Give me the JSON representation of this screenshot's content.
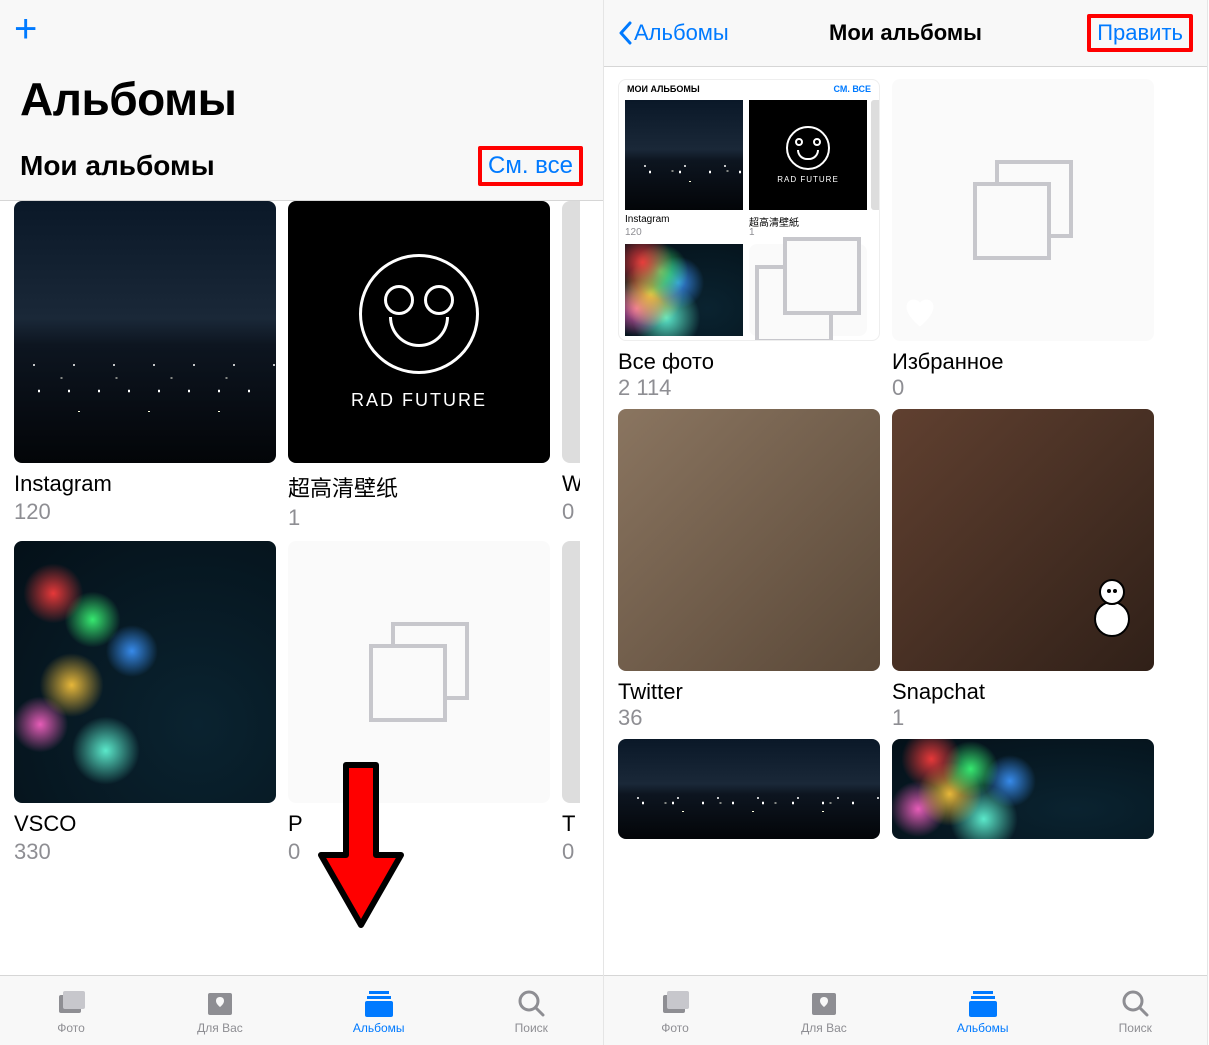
{
  "colors": {
    "accent": "#007aff",
    "highlight": "#ff0000",
    "gray": "#8e8e93"
  },
  "left": {
    "large_title": "Альбомы",
    "section_title": "Мои альбомы",
    "see_all_label": "См. все",
    "albums": [
      {
        "name": "Instagram",
        "count": "120"
      },
      {
        "name": "超高清壁纸",
        "count": "1"
      },
      {
        "name": "W",
        "count": "0"
      },
      {
        "name": "VSCO",
        "count": "330"
      },
      {
        "name": "P",
        "count": "0"
      },
      {
        "name": "T",
        "count": "0"
      }
    ]
  },
  "right": {
    "back_label": "Альбомы",
    "title": "Мои альбомы",
    "edit_label": "Править",
    "albums": [
      {
        "name": "Все фото",
        "count": "2 114"
      },
      {
        "name": "Избранное",
        "count": "0"
      },
      {
        "name": "Twitter",
        "count": "36"
      },
      {
        "name": "Snapchat",
        "count": "1"
      }
    ],
    "mini_collage": {
      "header_left": "МОИ АЛЬБОМЫ",
      "header_right": "СМ. ВСЕ",
      "item1_label": "Instagram",
      "item1_count": "120",
      "item2_label": "超高清壁紙",
      "item2_count": "1",
      "rad_text": "RAD FUTURE"
    }
  },
  "rad_future_text": "RAD FUTURE",
  "tabs": {
    "photos": "Фото",
    "for_you": "Для Вас",
    "albums": "Альбомы",
    "search": "Поиск"
  }
}
